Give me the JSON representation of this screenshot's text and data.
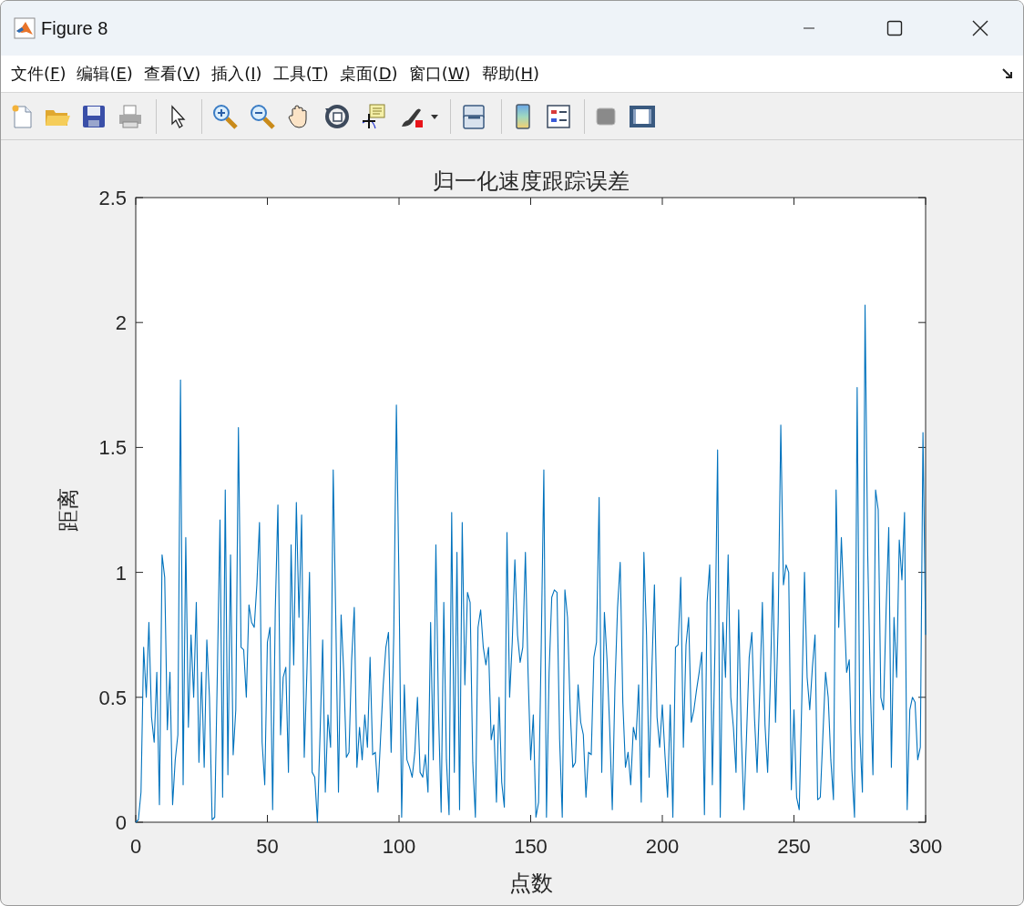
{
  "window": {
    "title": "Figure 8"
  },
  "menu": [
    {
      "label": "文件(F)"
    },
    {
      "label": "编辑(E)"
    },
    {
      "label": "查看(V)"
    },
    {
      "label": "插入(I)"
    },
    {
      "label": "工具(T)"
    },
    {
      "label": "桌面(D)"
    },
    {
      "label": "窗口(W)"
    },
    {
      "label": "帮助(H)"
    }
  ],
  "plot": {
    "chart_data": {
      "type": "line",
      "title": "归一化速度跟踪误差",
      "xlabel": "点数",
      "ylabel": "距离",
      "x": [
        0,
        1,
        2,
        3,
        4,
        5,
        6,
        7,
        8,
        9,
        10,
        11,
        12,
        13,
        14,
        15,
        16,
        17,
        18,
        19,
        20,
        21,
        22,
        23,
        24,
        25,
        26,
        27,
        28,
        29,
        30,
        31,
        32,
        33,
        34,
        35,
        36,
        37,
        38,
        39,
        40,
        41,
        42,
        43,
        44,
        45,
        46,
        47,
        48,
        49,
        50,
        51,
        52,
        53,
        54,
        55,
        56,
        57,
        58,
        59,
        60,
        61,
        62,
        63,
        64,
        65,
        66,
        67,
        68,
        69,
        70,
        71,
        72,
        73,
        74,
        75,
        76,
        77,
        78,
        79,
        80,
        81,
        82,
        83,
        84,
        85,
        86,
        87,
        88,
        89,
        90,
        91,
        92,
        93,
        94,
        95,
        96,
        97,
        98,
        99,
        100,
        101,
        102,
        103,
        104,
        105,
        106,
        107,
        108,
        109,
        110,
        111,
        112,
        113,
        114,
        115,
        116,
        117,
        118,
        119,
        120,
        121,
        122,
        123,
        124,
        125,
        126,
        127,
        128,
        129,
        130,
        131,
        132,
        133,
        134,
        135,
        136,
        137,
        138,
        139,
        140,
        141,
        142,
        143,
        144,
        145,
        146,
        147,
        148,
        149,
        150,
        151,
        152,
        153,
        154,
        155,
        156,
        157,
        158,
        159,
        160,
        161,
        162,
        163,
        164,
        165,
        166,
        167,
        168,
        169,
        170,
        171,
        172,
        173,
        174,
        175,
        176,
        177,
        178,
        179,
        180,
        181,
        182,
        183,
        184,
        185,
        186,
        187,
        188,
        189,
        190,
        191,
        192,
        193,
        194,
        195,
        196,
        197,
        198,
        199,
        200,
        201,
        202,
        203,
        204,
        205,
        206,
        207,
        208,
        209,
        210,
        211,
        212,
        213,
        214,
        215,
        216,
        217,
        218,
        219,
        220,
        221,
        222,
        223,
        224,
        225,
        226,
        227,
        228,
        229,
        230,
        231,
        232,
        233,
        234,
        235,
        236,
        237,
        238,
        239,
        240,
        241,
        242,
        243,
        244,
        245,
        246,
        247,
        248,
        249,
        250,
        251,
        252,
        253,
        254,
        255,
        256,
        257,
        258,
        259,
        260,
        261,
        262,
        263,
        264,
        265,
        266,
        267,
        268,
        269,
        270,
        271,
        272,
        273,
        274,
        275,
        276,
        277,
        278,
        279,
        280,
        281,
        282,
        283,
        284,
        285,
        286,
        287,
        288,
        289,
        290,
        291,
        292,
        293,
        294,
        295,
        296,
        297,
        298,
        299,
        300
      ],
      "xlim": [
        0,
        300
      ],
      "ylim": [
        0,
        2.5
      ],
      "xticks": [
        0,
        50,
        100,
        150,
        200,
        250,
        300
      ],
      "yticks": [
        0,
        0.5,
        1,
        1.5,
        2,
        2.5
      ],
      "series": [
        {
          "color": "#0072bd",
          "values": [
            0,
            0.01,
            0.12,
            0.7,
            0.5,
            0.8,
            0.42,
            0.32,
            0.6,
            0.07,
            1.07,
            0.98,
            0.37,
            0.6,
            0.07,
            0.25,
            0.35,
            1.77,
            0.15,
            1.14,
            0.38,
            0.75,
            0.5,
            0.88,
            0.24,
            0.6,
            0.22,
            0.73,
            0.5,
            0.01,
            0.02,
            0.6,
            1.21,
            0.1,
            1.33,
            0.19,
            1.07,
            0.27,
            0.45,
            1.58,
            0.7,
            0.69,
            0.5,
            0.87,
            0.8,
            0.78,
            0.95,
            1.2,
            0.32,
            0.15,
            0.72,
            0.78,
            0.05,
            0.85,
            1.27,
            0.35,
            0.58,
            0.62,
            0.2,
            1.11,
            0.63,
            1.28,
            0.82,
            1.23,
            0.26,
            0.6,
            1.0,
            0.2,
            0.18,
            0,
            0.35,
            0.73,
            0.12,
            0.43,
            0.3,
            1.41,
            0.8,
            0.12,
            0.83,
            0.6,
            0.26,
            0.28,
            0.65,
            0.86,
            0.22,
            0.38,
            0.25,
            0.43,
            0.3,
            0.66,
            0.27,
            0.28,
            0.12,
            0.34,
            0.55,
            0.7,
            0.76,
            0.28,
            0.75,
            1.67,
            0.95,
            0.02,
            0.55,
            0.25,
            0.22,
            0.18,
            0.28,
            0.5,
            0.2,
            0.18,
            0.27,
            0.12,
            0.8,
            0.25,
            1.11,
            0.44,
            0.04,
            0.88,
            0.25,
            0.03,
            1.24,
            0.2,
            1.08,
            0.05,
            1.2,
            0.55,
            0.92,
            0.88,
            0.24,
            0.02,
            0.78,
            0.85,
            0.7,
            0.63,
            0.7,
            0.33,
            0.39,
            0.08,
            0.5,
            0.16,
            0.06,
            1.16,
            0.5,
            0.72,
            1.05,
            0.75,
            0.64,
            0.7,
            1.08,
            0.6,
            0.25,
            0.43,
            0.02,
            0.08,
            0.7,
            1.41,
            0.02,
            0.6,
            0.9,
            0.93,
            0.92,
            0.33,
            0.02,
            0.93,
            0.82,
            0.45,
            0.22,
            0.24,
            0.55,
            0.4,
            0.35,
            0.1,
            0.28,
            0.27,
            0.66,
            0.72,
            1.3,
            0.2,
            0.84,
            0.65,
            0.38,
            0.05,
            0.54,
            0.86,
            1.04,
            0.48,
            0.22,
            0.28,
            0.15,
            0.38,
            0.33,
            0.55,
            0.08,
            1.08,
            0.75,
            0.18,
            0.6,
            0.95,
            0.42,
            0.3,
            0.47,
            0.27,
            0.1,
            0.47,
            0.02,
            0.7,
            0.71,
            0.98,
            0.3,
            0.71,
            0.82,
            0.4,
            0.45,
            0.53,
            0.6,
            0.68,
            0.03,
            0.88,
            1.03,
            0.15,
            0.7,
            1.49,
            0.02,
            0.8,
            0.58,
            1.07,
            0.5,
            0.38,
            0.2,
            0.85,
            0.35,
            0.05,
            0.35,
            0.66,
            0.76,
            0.42,
            0.2,
            0.52,
            0.88,
            0.39,
            0.2,
            0.55,
            1.0,
            0.4,
            0.8,
            1.59,
            0.95,
            1.03,
            1.0,
            0.13,
            0.45,
            0.1,
            0.05,
            0.5,
            1.0,
            0.58,
            0.45,
            0.62,
            0.75,
            0.09,
            0.1,
            0.35,
            0.6,
            0.5,
            0.25,
            0.09,
            1.33,
            0.78,
            1.14,
            0.87,
            0.6,
            0.65,
            0.21,
            0.02,
            1.74,
            0.36,
            0.12,
            2.07,
            1.08,
            0.54,
            0.19,
            1.33,
            1.25,
            0.5,
            0.45,
            0.85,
            1.18,
            0.22,
            0.82,
            0.58,
            1.13,
            0.97,
            1.24,
            0.05,
            0.45,
            0.5,
            0.48,
            0.25,
            0.3,
            1.56,
            0.75
          ]
        }
      ]
    }
  }
}
